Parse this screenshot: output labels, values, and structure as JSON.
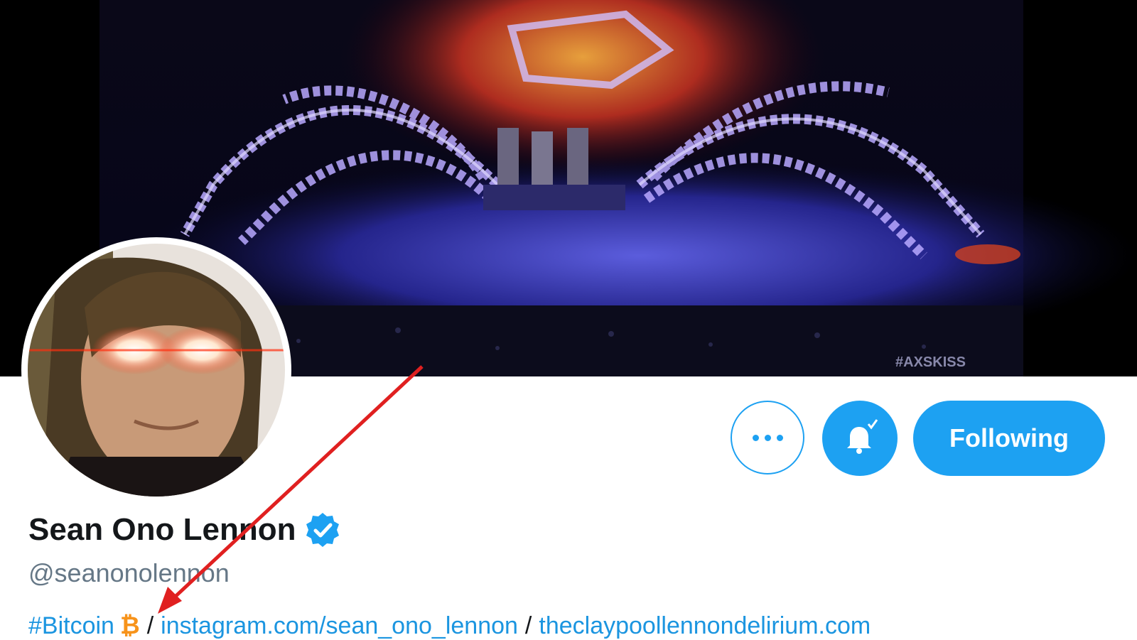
{
  "profile": {
    "name": "Sean Ono Lennon",
    "handle": "@seanonolennon",
    "verified": true,
    "bio": {
      "hashtag": "#Bitcoin",
      "bitcoin_symbol": "₿",
      "separator": "/",
      "link1": "instagram.com/sean_ono_lennon",
      "link2": "theclaypoollennondelirium.com"
    }
  },
  "banner": {
    "watermark": "#AXSKISS"
  },
  "actions": {
    "following_label": "Following",
    "more_icon": "more-horizontal-icon",
    "bell_icon": "bell-check-icon"
  },
  "colors": {
    "accent": "#1da1f2",
    "link": "#1b95e0",
    "bitcoin": "#f7931a",
    "arrow": "#e02020"
  }
}
